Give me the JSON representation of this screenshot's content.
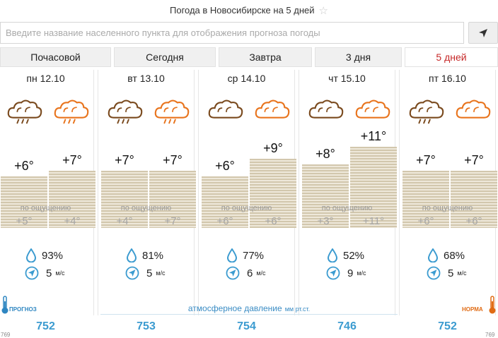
{
  "title": "Погода в Новосибирске на 5 дней",
  "search": {
    "placeholder": "Введите название населенного пункта для отображения прогноза погоды"
  },
  "tabs": [
    "Почасовой",
    "Сегодня",
    "Завтра",
    "3 дня",
    "5 дней"
  ],
  "active_tab": "5 дней",
  "feels_label": "по ощущению",
  "wind_unit": "м/с",
  "pressure_label": "атмосферное давление",
  "pressure_unit": "мм рт.ст.",
  "legend_left": "ПРОГНОЗ",
  "legend_right": "НОРМА",
  "norm_left": "769",
  "norm_right": "769",
  "days": [
    {
      "date": "пн 12.10",
      "t1": "+6°",
      "t2": "+7°",
      "f1": "+5°",
      "f2": "+4°",
      "humidity": "93%",
      "wind": "5",
      "pressure": "752",
      "icon_day": "cloud-rain-icon",
      "icon_night": "cloud-rain-icon"
    },
    {
      "date": "вт 13.10",
      "t1": "+7°",
      "t2": "+7°",
      "f1": "+4°",
      "f2": "+7°",
      "humidity": "81%",
      "wind": "5",
      "pressure": "753",
      "icon_day": "cloud-rain-icon",
      "icon_night": "cloud-rain-icon"
    },
    {
      "date": "ср 14.10",
      "t1": "+6°",
      "t2": "+9°",
      "f1": "+6°",
      "f2": "+6°",
      "humidity": "77%",
      "wind": "6",
      "pressure": "754",
      "icon_day": "cloudy-icon",
      "icon_night": "cloudy-icon"
    },
    {
      "date": "чт 15.10",
      "t1": "+8°",
      "t2": "+11°",
      "f1": "+3°",
      "f2": "+11°",
      "humidity": "52%",
      "wind": "9",
      "pressure": "746",
      "icon_day": "cloudy-icon",
      "icon_night": "cloudy-icon"
    },
    {
      "date": "пт 16.10",
      "t1": "+7°",
      "t2": "+7°",
      "f1": "+6°",
      "f2": "+6°",
      "humidity": "68%",
      "wind": "5",
      "pressure": "752",
      "icon_day": "cloud-rain-icon",
      "icon_night": "cloudy-icon"
    }
  ],
  "colors": {
    "day_icon": "#7a4a1e",
    "night_icon": "#e8741d",
    "accent": "#3b9bd0",
    "active_tab": "#c62828"
  }
}
